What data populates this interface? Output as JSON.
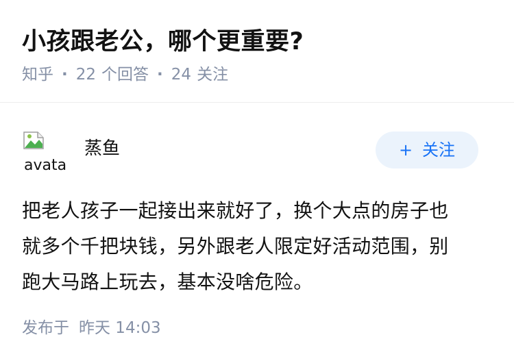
{
  "question": {
    "title": "小孩跟老公，哪个更重要?",
    "source": "知乎",
    "answer_count": "22",
    "answer_label": "个回答",
    "follow_count": "24",
    "follow_label": "关注"
  },
  "answer": {
    "author": {
      "name": "蒸鱼",
      "avatar_alt": "avatar",
      "avatar_icon": "broken-image-icon"
    },
    "follow_button": {
      "icon": "+",
      "label": "关注"
    },
    "content_lines": [
      "把老人孩子一起接出来就好了，换个大点的房子也",
      "就多个千把块钱，另外跟老人限定好活动范围，别",
      "跑大马路上玩去，基本没啥危险。"
    ],
    "published_label": "发布于",
    "published_time": "昨天 14:03"
  },
  "colors": {
    "text_primary": "#121212",
    "text_secondary": "#8590a6",
    "accent": "#1772f6",
    "accent_bg": "#ebf3fc",
    "divider": "#ededed"
  }
}
